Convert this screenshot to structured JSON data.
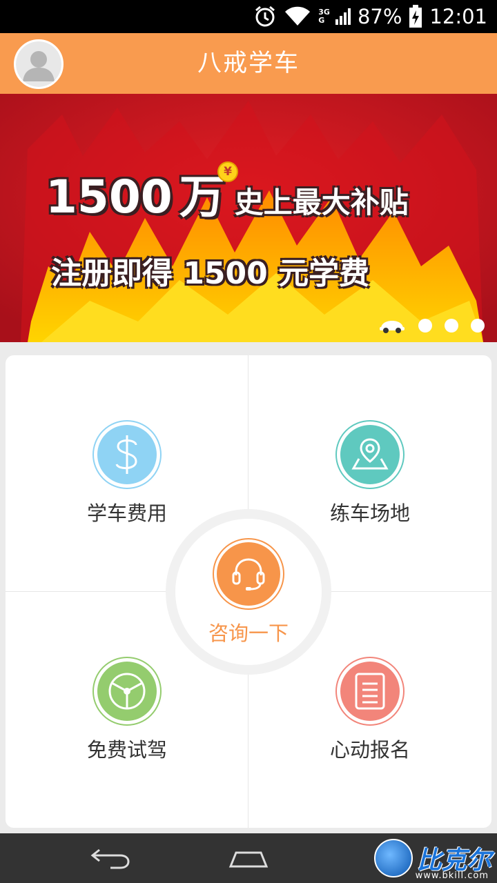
{
  "status_bar": {
    "network": [
      "3G",
      "G"
    ],
    "battery": "87%",
    "time": "12:01"
  },
  "header": {
    "title": "八戒学车"
  },
  "banner": {
    "amount": "1500",
    "unit": "万",
    "headline": "史上最大补贴",
    "coin_symbol": "¥",
    "subline": "注册即得 1500 元学费",
    "pages": 3
  },
  "menu": {
    "fee": "学车费用",
    "venue": "练车场地",
    "consult": "咨询一下",
    "trial": "免费试驾",
    "signup": "心动报名"
  },
  "watermark": {
    "text": "比克尔",
    "url": "www.bkill.com"
  },
  "colors": {
    "header": "#f99b4f",
    "fee": "#8fd3f4",
    "venue": "#5fc9bf",
    "consult": "#f7954a",
    "trial": "#94cc6e",
    "signup": "#f2857a"
  }
}
